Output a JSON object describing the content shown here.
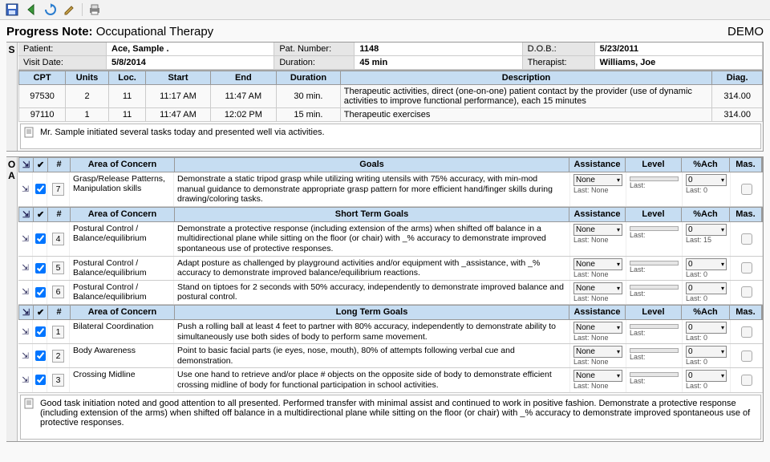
{
  "title": {
    "label": "Progress Note:",
    "subject": "Occupational Therapy"
  },
  "mode": "DEMO",
  "header": {
    "patient_lbl": "Patient:",
    "patient": "Ace, Sample .",
    "patnum_lbl": "Pat. Number:",
    "patnum": "1148",
    "dob_lbl": "D.O.B.:",
    "dob": "5/23/2011",
    "visit_lbl": "Visit Date:",
    "visit": "5/8/2014",
    "dur_lbl": "Duration:",
    "dur": "45 min",
    "ther_lbl": "Therapist:",
    "ther": "Williams, Joe"
  },
  "cpt_cols": [
    "CPT",
    "Units",
    "Loc.",
    "Start",
    "End",
    "Duration",
    "Description",
    "Diag."
  ],
  "cpt_rows": [
    {
      "cpt": "97530",
      "units": "2",
      "loc": "11",
      "start": "11:17 AM",
      "end": "11:47 AM",
      "dur": "30 min.",
      "desc": "Therapeutic activities, direct (one-on-one) patient contact by the provider (use of dynamic activities to improve functional performance), each 15 minutes",
      "diag": "314.00"
    },
    {
      "cpt": "97110",
      "units": "1",
      "loc": "11",
      "start": "11:47 AM",
      "end": "12:02 PM",
      "dur": "15 min.",
      "desc": "Therapeutic exercises",
      "diag": "314.00"
    }
  ],
  "s_note": "Mr. Sample initiated several tasks today and presented well via activities.",
  "goal_hdrs": {
    "check": "✔",
    "pound": "#",
    "area": "Area of Concern",
    "goals_primary": "Goals",
    "goals_short": "Short Term Goals",
    "goals_long": "Long Term Goals",
    "assist": "Assistance",
    "level": "Level",
    "ach": "%Ach",
    "mas": "Mas."
  },
  "assist_default": "None",
  "ach_default": "0",
  "last_label": "Last:",
  "last_none": "None",
  "last_zero": "0",
  "primary_goals": [
    {
      "n": "7",
      "area": "Grasp/Release Patterns, Manipulation skills",
      "goal": "Demonstrate a static tripod grasp while utilizing writing utensils with 75% accuracy, with min-mod manual guidance to demonstrate appropriate grasp pattern for more efficient hand/finger skills during drawing/coloring tasks.",
      "last_ach": "0"
    }
  ],
  "short_goals": [
    {
      "n": "4",
      "area": "Postural Control / Balance/equilibrium",
      "goal": "Demonstrate a protective response (including extension of the arms) when shifted off balance in a multidirectional plane while sitting on the floor (or chair) with _% accuracy to demonstrate improved spontaneous use of protective responses.",
      "last_ach": "15"
    },
    {
      "n": "5",
      "area": "Postural Control / Balance/equilibrium",
      "goal": "Adapt posture as challenged by playground activities and/or equipment with _assistance, with _% accuracy to demonstrate improved balance/equilibrium reactions.",
      "last_ach": "0"
    },
    {
      "n": "6",
      "area": "Postural Control / Balance/equilibrium",
      "goal": "Stand on tiptoes for 2 seconds with 50% accuracy, independently to demonstrate improved balance and postural control.",
      "last_ach": "0"
    }
  ],
  "long_goals": [
    {
      "n": "1",
      "area": "Bilateral Coordination",
      "goal": "Push a rolling ball at least 4 feet to partner with 80% accuracy, independently to demonstrate ability to simultaneously use both sides of body to perform same movement.",
      "last_ach": "0"
    },
    {
      "n": "2",
      "area": "Body Awareness",
      "goal": "Point to basic facial parts (ie eyes, nose, mouth), 80% of attempts following verbal cue and demonstration.",
      "last_ach": "0"
    },
    {
      "n": "3",
      "area": "Crossing Midline",
      "goal": "Use one hand to retrieve and/or place # objects on the opposite side of body to demonstrate efficient crossing midline of body for functional participation in school activities.",
      "last_ach": "0"
    }
  ],
  "o_note": "Good task initiation noted and good attention to all presented.  Performed transfer with minimal assist and continued to work in positive fashion.  Demonstrate a protective response (including extension of the arms) when shifted off balance in a multidirectional plane while sitting on the floor (or chair) with _% accuracy to demonstrate improved spontaneous use of protective responses.",
  "section_letters": {
    "s": "S",
    "o": "O",
    "a": "A"
  }
}
